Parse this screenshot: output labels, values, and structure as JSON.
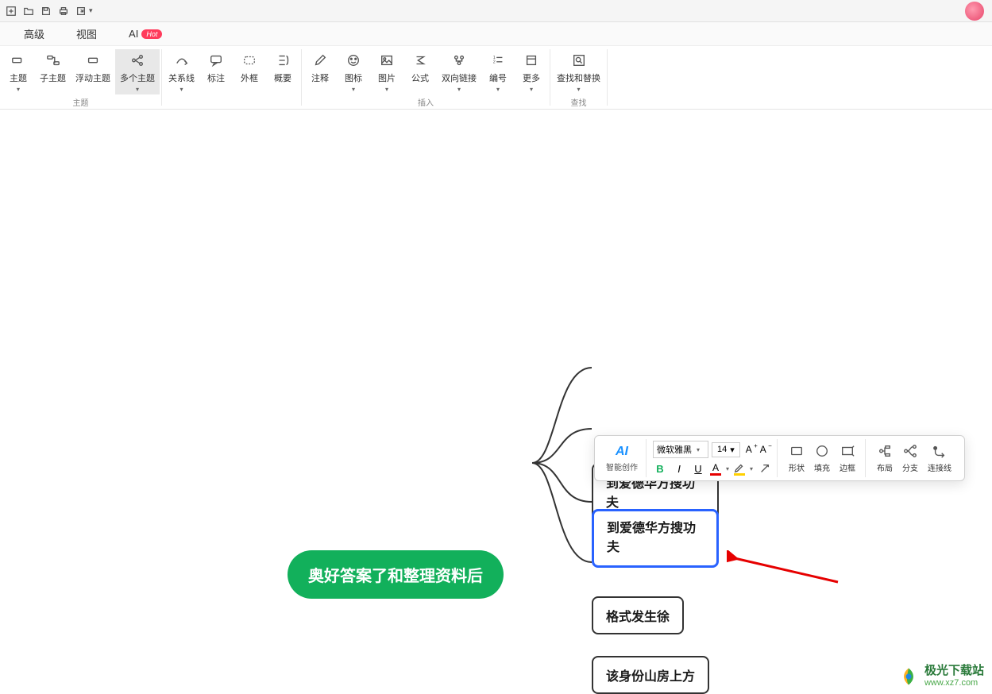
{
  "menu": {
    "advanced": "高级",
    "view": "视图",
    "ai": "AI",
    "hot": "Hot"
  },
  "ribbon": {
    "groups": {
      "topic": {
        "label": "主题",
        "items": {
          "topic": "主题",
          "subtopic": "子主题",
          "floating": "浮动主题",
          "multiple": "多个主题"
        }
      },
      "edge": {
        "items": {
          "relation": "关系线",
          "callout": "标注",
          "boundary": "外框",
          "summary": "概要"
        }
      },
      "insert": {
        "label": "插入",
        "items": {
          "note": "注释",
          "icon": "图标",
          "image": "图片",
          "formula": "公式",
          "hyperlink": "双向链接",
          "number": "编号",
          "more": "更多"
        }
      },
      "find": {
        "label": "查找",
        "items": {
          "findreplace": "查找和替换"
        }
      }
    }
  },
  "mindmap": {
    "root": "奥好答案了和整理资料后",
    "children": [
      "到爱德华方搜功夫",
      "到爱德华方搜功夫",
      "格式发生徐",
      "该身份山房上方"
    ]
  },
  "floatToolbar": {
    "ai": {
      "title": "AI",
      "label": "智能创作"
    },
    "font": {
      "name": "微软雅黑",
      "size": "14"
    },
    "shape": "形状",
    "fill": "填充",
    "border": "边框",
    "layout": "布局",
    "branch": "分支",
    "connector": "连接线"
  },
  "watermark": {
    "title": "极光下载站",
    "url": "www.xz7.com"
  }
}
